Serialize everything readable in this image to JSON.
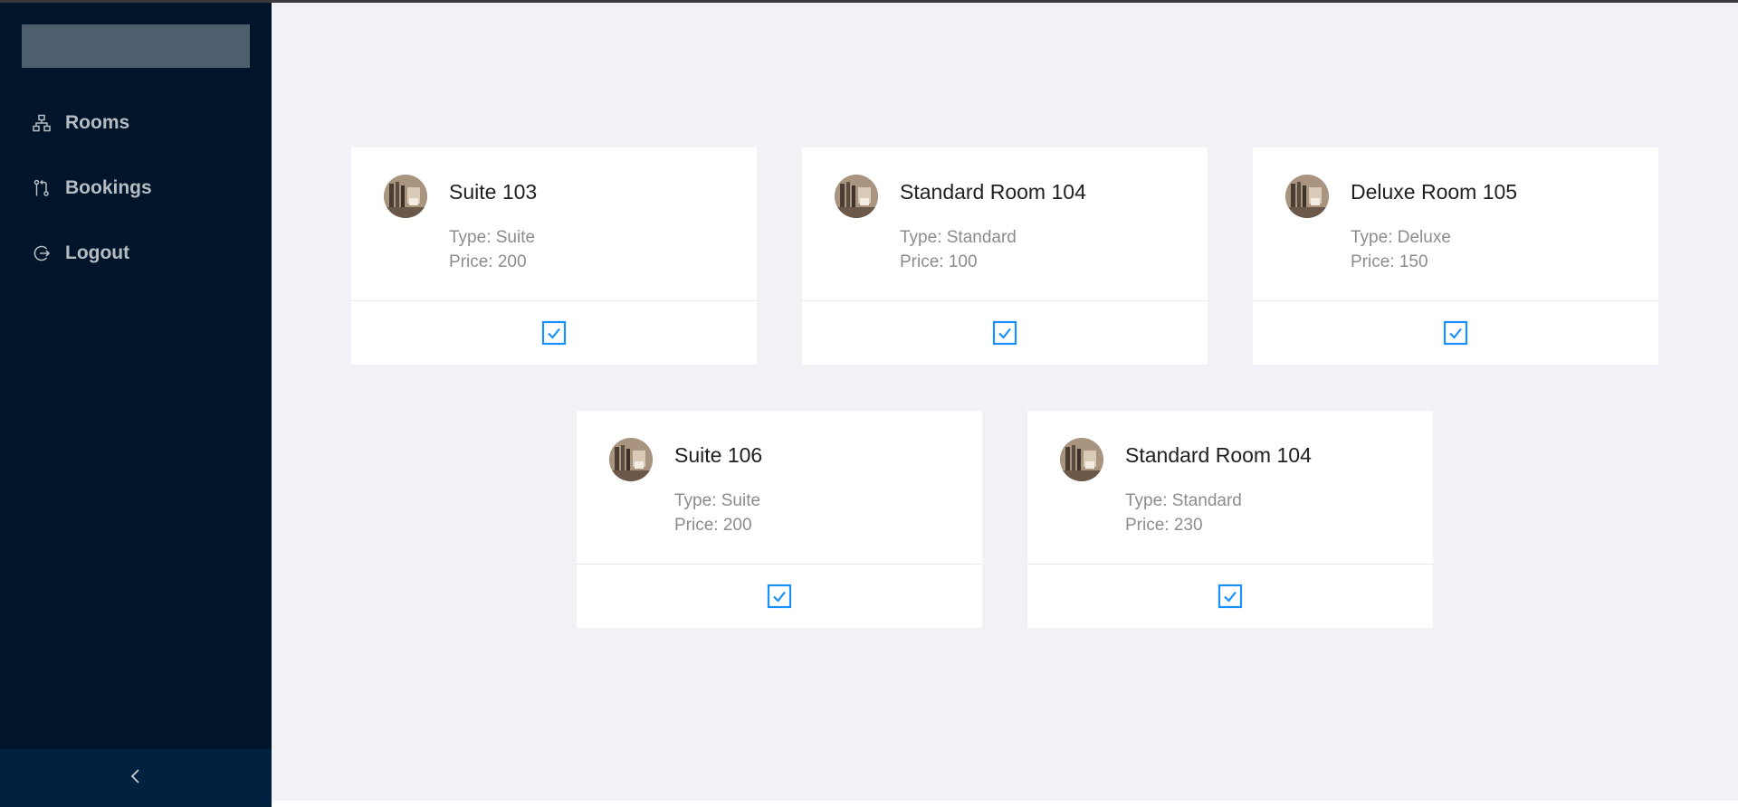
{
  "sidebar": {
    "items": [
      {
        "label": "Rooms",
        "icon": "cluster-icon"
      },
      {
        "label": "Bookings",
        "icon": "pull-request-icon"
      },
      {
        "label": "Logout",
        "icon": "logout-icon"
      }
    ],
    "collapse_icon": "chevron-left-icon"
  },
  "rooms": [
    {
      "title": "Suite 103",
      "type": "Type: Suite",
      "price": "Price: 200"
    },
    {
      "title": "Standard Room 104",
      "type": "Type: Standard",
      "price": "Price: 100"
    },
    {
      "title": "Deluxe Room 105",
      "type": "Type: Deluxe",
      "price": "Price: 150"
    },
    {
      "title": "Suite 106",
      "type": "Type: Suite",
      "price": "Price: 200"
    },
    {
      "title": "Standard Room 104",
      "type": "Type: Standard",
      "price": "Price: 230"
    }
  ],
  "colors": {
    "sidebar_bg": "#001529",
    "accent": "#1890ff",
    "content_bg": "#f0f2f5"
  }
}
